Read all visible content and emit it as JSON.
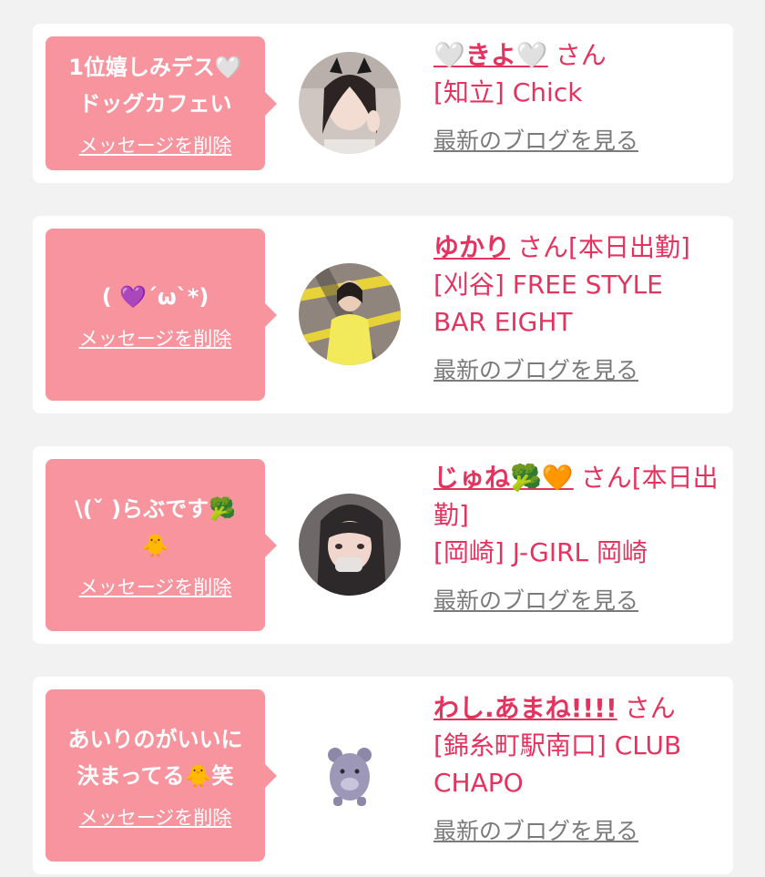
{
  "accent_color": "#e4335f",
  "bubble_color": "#f7949e",
  "cards": [
    {
      "message": "1位嬉しみデス🤍\nドッグカフェい",
      "delete_label": "メッセージを削除",
      "name": "🤍きよ🤍",
      "suffix": "さん",
      "shop": "[知立] Chick",
      "blog_label": "最新のブログを見る",
      "avatar": "photo-avatar-girl-peace-sign"
    },
    {
      "message": "( 💜´ω`*)",
      "delete_label": "メッセージを削除",
      "name": "ゆかり",
      "suffix": "さん[本日出勤]",
      "shop": "[刈谷] FREE STYLE BAR EIGHT",
      "blog_label": "最新のブログを見る",
      "avatar": "photo-avatar-yellow-hoodie"
    },
    {
      "message": "\\(ˇ )らぶです🥦\n🐥",
      "delete_label": "メッセージを削除",
      "name": "じゅね🥦🧡",
      "suffix": "さん[本日出勤]",
      "shop": "[岡崎] J-GIRL 岡崎",
      "blog_label": "最新のブログを見る",
      "avatar": "photo-avatar-girl-selfie"
    },
    {
      "message": "あいりのがいいに\n決まってる🐥笑",
      "delete_label": "メッセージを削除",
      "name": "わし.あまね!!!!",
      "suffix": "さん",
      "shop": "[錦糸町駅南口] CLUB CHAPO",
      "blog_label": "最新のブログを見る",
      "avatar": "default-mascot-icon"
    }
  ]
}
